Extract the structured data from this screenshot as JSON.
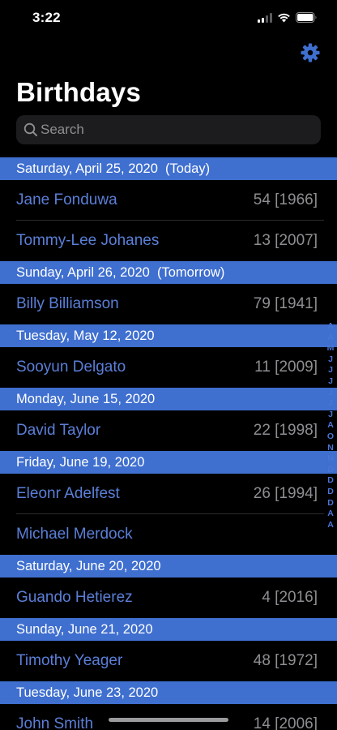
{
  "status_bar": {
    "time": "3:22"
  },
  "header": {
    "title": "Birthdays"
  },
  "search": {
    "placeholder": "Search"
  },
  "colors": {
    "accent": "#3f6fcf",
    "name_text": "#5b7fd8",
    "secondary_text": "#8e8e93",
    "background": "#000000"
  },
  "sections": [
    {
      "header": "Saturday, April 25, 2020  (Today)",
      "rows": [
        {
          "name": "Jane Fonduwa",
          "age": "54 [1966]"
        },
        {
          "name": "Tommy-Lee Johanes",
          "age": "13 [2007]"
        }
      ]
    },
    {
      "header": "Sunday, April 26, 2020  (Tomorrow)",
      "rows": [
        {
          "name": "Billy Billiamson",
          "age": "79 [1941]"
        }
      ]
    },
    {
      "header": "Tuesday, May 12, 2020",
      "rows": [
        {
          "name": "Sooyun Delgato",
          "age": "11 [2009]"
        }
      ]
    },
    {
      "header": "Monday, June 15, 2020",
      "rows": [
        {
          "name": "David Taylor",
          "age": "22 [1998]"
        }
      ]
    },
    {
      "header": "Friday, June 19, 2020",
      "rows": [
        {
          "name": "Eleonr Adelfest",
          "age": "26 [1994]"
        },
        {
          "name": "Michael Merdock",
          "age": ""
        }
      ]
    },
    {
      "header": "Saturday, June 20, 2020",
      "rows": [
        {
          "name": "Guando Hetierez",
          "age": "4 [2016]"
        }
      ]
    },
    {
      "header": "Sunday, June 21, 2020",
      "rows": [
        {
          "name": "Timothy Yeager",
          "age": "48 [1972]"
        }
      ]
    },
    {
      "header": "Tuesday, June 23, 2020",
      "rows": [
        {
          "name": "John Smith",
          "age": "14 [2006]"
        }
      ]
    }
  ],
  "section_index": [
    "A",
    "A",
    "M",
    "J",
    "J",
    "J",
    "J",
    "J",
    "J",
    "A",
    "O",
    "N",
    "N",
    "D",
    "D",
    "D",
    "D",
    "A",
    "A"
  ]
}
